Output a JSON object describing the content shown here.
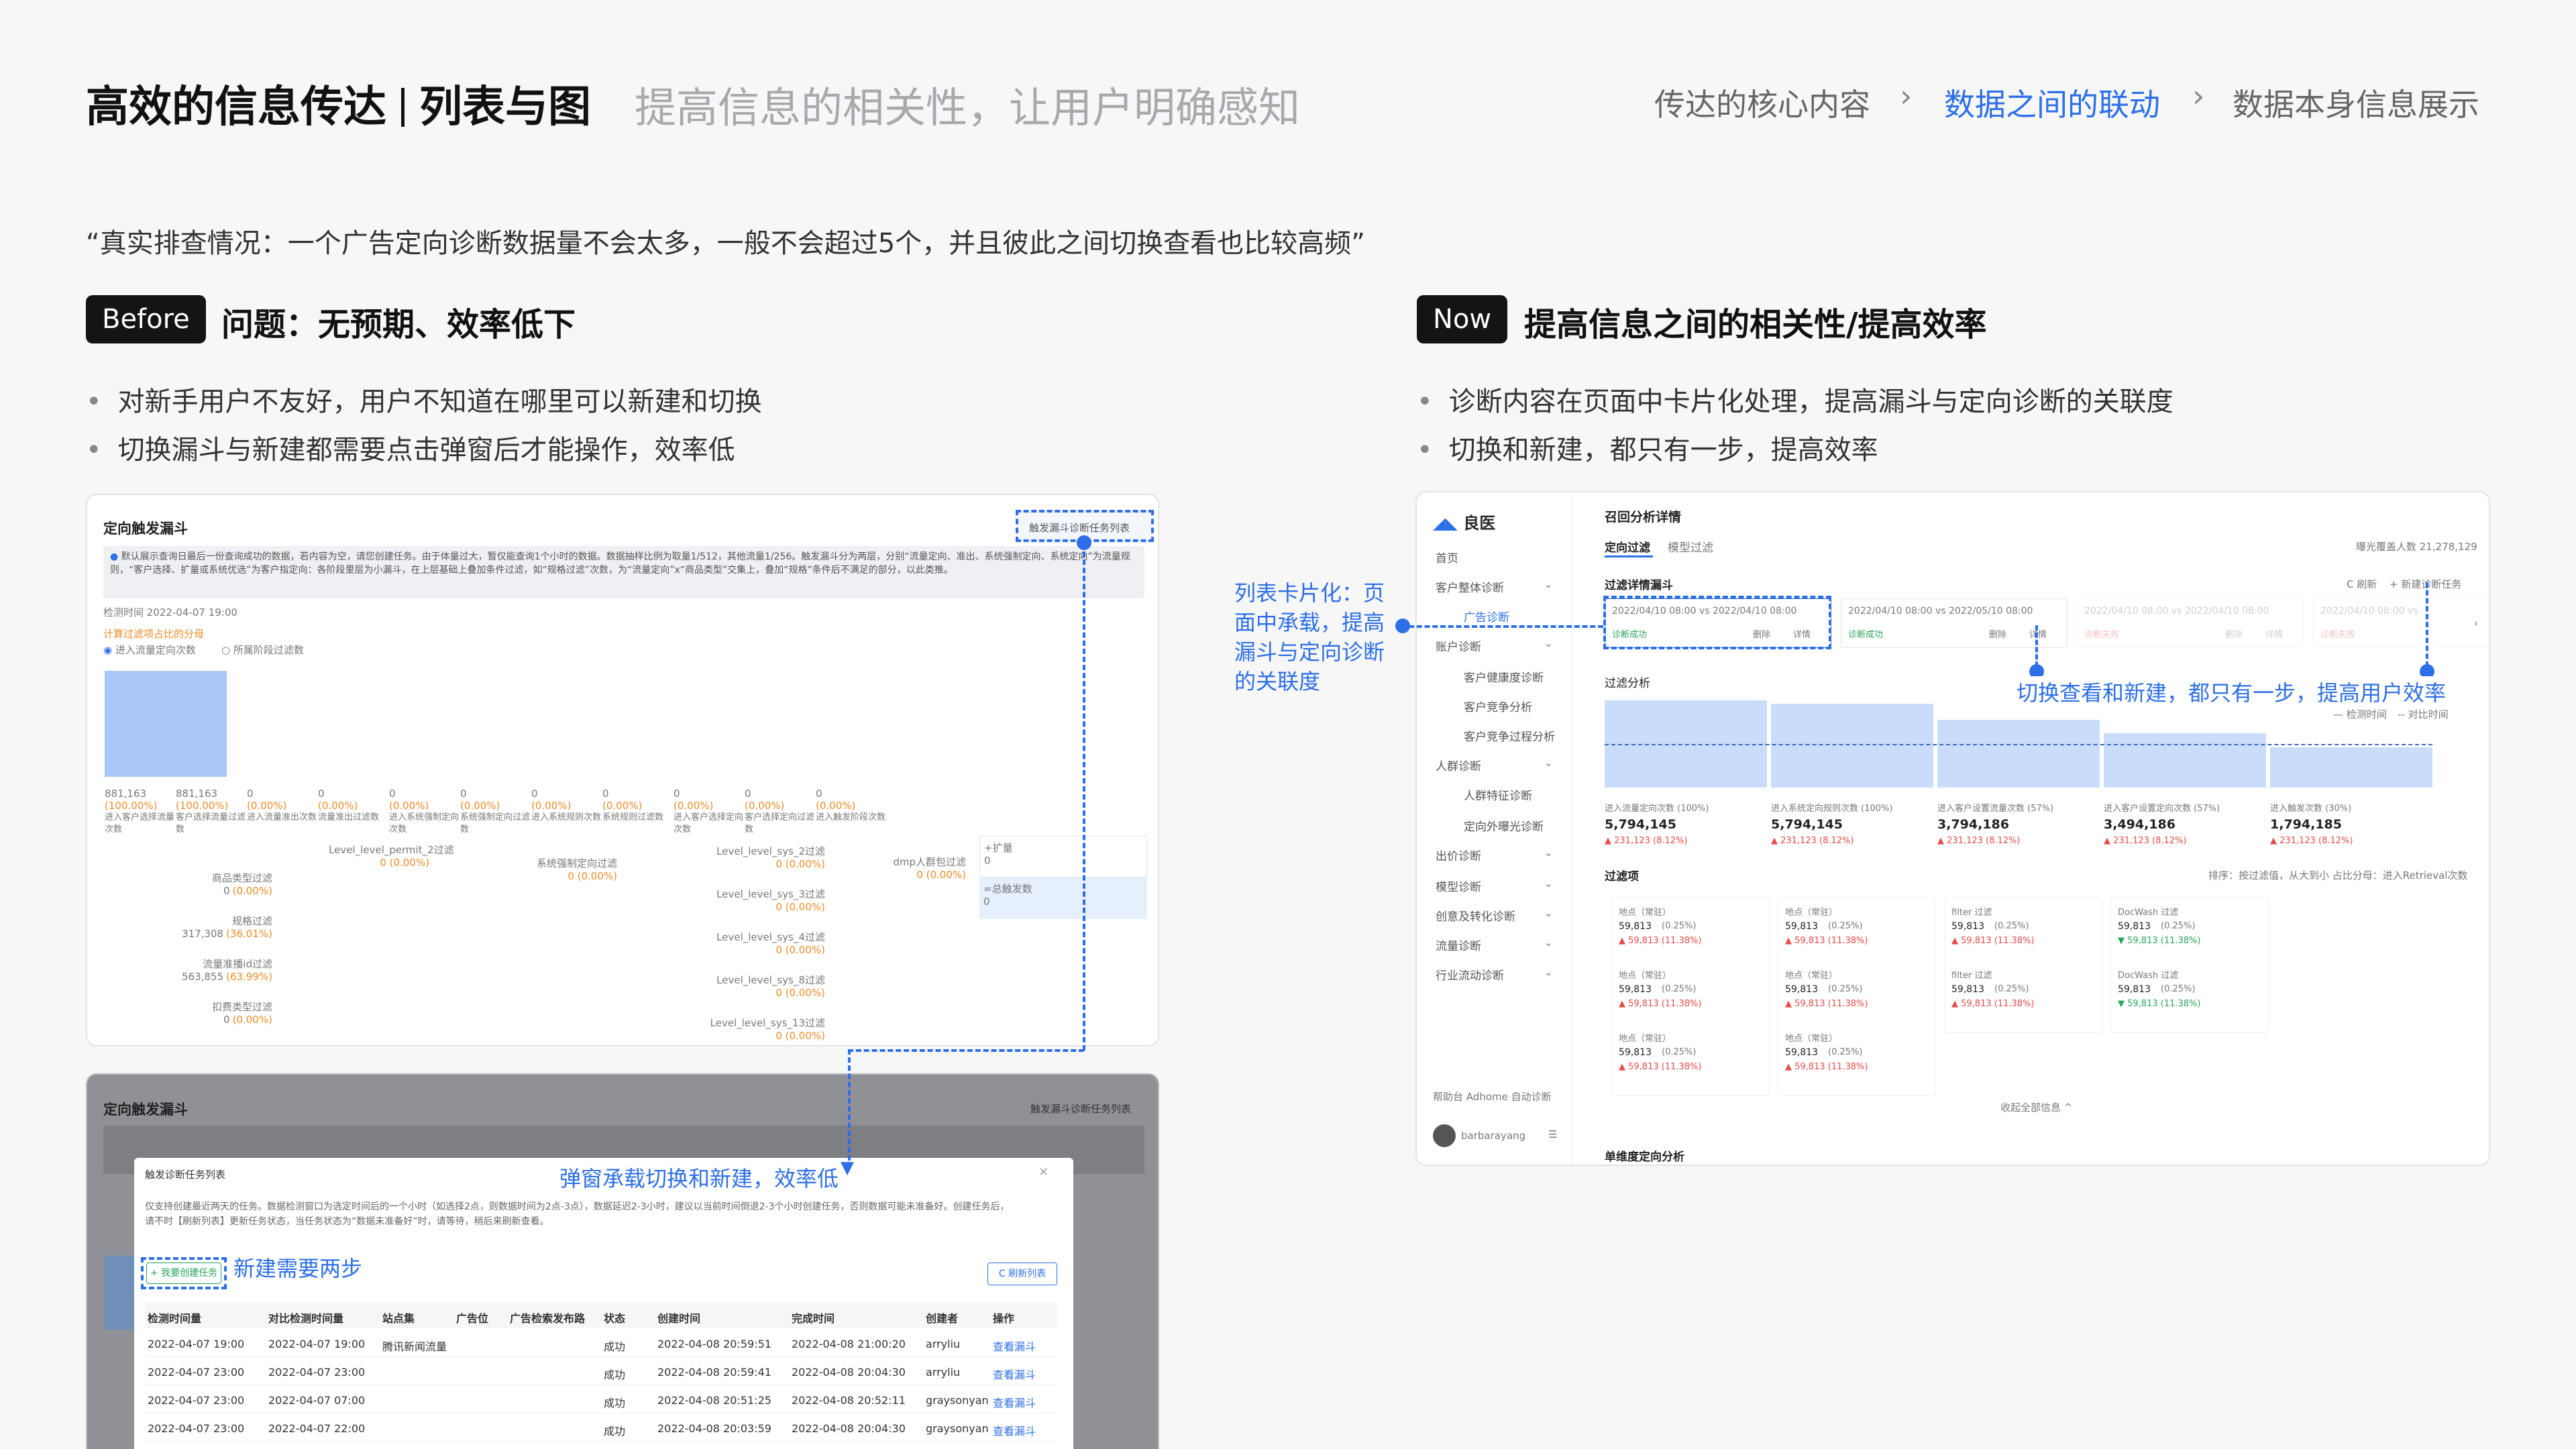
{
  "header": {
    "title_a": "高效的信息传达",
    "title_b": "列表与图",
    "subtitle": "提高信息的相关性，让用户明确感知",
    "breadcrumbs": [
      "传达的核心内容",
      "数据之间的联动",
      "数据本身信息展示"
    ],
    "active_crumb_index": 1
  },
  "quote": "“真实排查情况：一个广告定向诊断数据量不会太多，一般不会超过5个，并且彼此之间切换查看也比较高频”",
  "before": {
    "tag": "Before",
    "heading": "问题：无预期、效率低下",
    "bullets": [
      "对新手用户不友好，用户不知道在哪里可以新建和切换",
      "切换漏斗与新建都需要点击弹窗后才能操作，效率低"
    ]
  },
  "now": {
    "tag": "Now",
    "heading": "提高信息之间的相关性/提高效率",
    "bullets": [
      "诊断内容在页面中卡片化处理，提高漏斗与定向诊断的关联度",
      "切换和新建，都只有一步，提高效率"
    ]
  },
  "annotations": {
    "popup": "弹窗承载切换和新建，效率低",
    "two_steps": "新建需要两步",
    "cards": "列表卡片化：页面中承载，提高漏斗与定向诊断的关联度",
    "one_step": "切换查看和新建，都只有一步，提高用户效率"
  },
  "before_shot": {
    "title": "定向触发漏斗",
    "task_list_btn": "触发漏斗诊断任务列表",
    "notice": "默认展示查询日最后一份查询成功的数据，若内容为空，请您创建任务。由于体量过大，暂仅能查询1个小时的数据。数据抽样比例为取量1/512，其他流量1/256。触发漏斗分为两层，分别“流量定向、准出、系统强制定向、系统定向”为流量规则，“客户选择、扩量或系统优选”为客户指定向：各阶段里层为小漏斗，在上层基础上叠加条件过滤，如“规格过滤”次数，为“流量定向”x“商品类型”交集上，叠加“规格”条件后不满足的部分，以此类推。",
    "check_time": "检测时间 2022-04-07 19:00",
    "filter_label": "计算过滤项占比的分母",
    "radio_a": "进入流量定向次数",
    "radio_b": "所属阶段过滤数",
    "stage_cols": [
      {
        "v": "881,163",
        "p": "(100.00%)",
        "l": "进入客户选择流量次数"
      },
      {
        "v": "881,163",
        "p": "(100.00%)",
        "l": "客户选择流量过滤数"
      },
      {
        "v": "0",
        "p": "(0.00%)",
        "l": "进入流量准出次数"
      },
      {
        "v": "0",
        "p": "(0.00%)",
        "l": "流量准出过滤数"
      },
      {
        "v": "0",
        "p": "(0.00%)",
        "l": "进入系统强制定向次数"
      },
      {
        "v": "0",
        "p": "(0.00%)",
        "l": "系统强制定向过滤数"
      },
      {
        "v": "0",
        "p": "(0.00%)",
        "l": "进入系统规则次数"
      },
      {
        "v": "0",
        "p": "(0.00%)",
        "l": "系统规则过滤数"
      },
      {
        "v": "0",
        "p": "(0.00%)",
        "l": "进入客户选择定向次数"
      },
      {
        "v": "0",
        "p": "(0.00%)",
        "l": "客户选择定向过滤数"
      },
      {
        "v": "0",
        "p": "(0.00%)",
        "l": "进入触发阶段次数"
      }
    ],
    "sub_filters": [
      {
        "l": "商品类型过滤",
        "v": "0",
        "p": "(0.00%)"
      },
      {
        "l": "规格过滤",
        "v": "317,308",
        "p": "(36.01%)"
      },
      {
        "l": "流量准播id过滤",
        "v": "563,855",
        "p": "(63.99%)"
      },
      {
        "l": "扣费类型过滤",
        "v": "0",
        "p": "(0.00%)"
      }
    ],
    "level_filters": [
      "Level_level_sys_2过滤",
      "Level_level_sys_3过滤",
      "Level_level_sys_4过滤",
      "Level_level_sys_8过滤",
      "Level_level_sys_13过滤"
    ],
    "level_permit": "Level_level_permit_2过滤",
    "sys_force": "系统强制定向过滤",
    "dmp": "dmp人群包过滤",
    "expand": "扩量",
    "total_trigger": "总触发数"
  },
  "popup_shot": {
    "title": "定向触发漏斗",
    "task_list_btn": "触发漏斗诊断任务列表",
    "dialog_title": "触发诊断任务列表",
    "dialog_desc": "仅支持创建最近两天的任务。数据检测窗口为选定时间后的一个小时（如选择2点，则数据时间为2点-3点），数据延迟2-3小时，建议以当前时间倒退2-3个小时创建任务，否则数据可能未准备好。创建任务后，请不时【刷新列表】更新任务状态，当任务状态为“数据未准备好”时，请等待，稍后来刷新查看。",
    "create_btn": "+ 我要创建任务",
    "refresh_btn": "C 刷新列表",
    "columns": [
      "检测时间量",
      "对比检测时间量",
      "站点集",
      "广告位",
      "广告检索发布路",
      "状态",
      "创建时间",
      "完成时间",
      "创建者",
      "操作"
    ],
    "rows": [
      [
        "2022-04-07 19:00",
        "2022-04-07 19:00",
        "腾讯新闻流量",
        "",
        "",
        "成功",
        "2022-04-08 20:59:51",
        "2022-04-08 21:00:20",
        "arryliu",
        "查看漏斗"
      ],
      [
        "2022-04-07 23:00",
        "2022-04-07 23:00",
        "",
        "",
        "",
        "成功",
        "2022-04-08 20:59:41",
        "2022-04-08 20:04:30",
        "arryliu",
        "查看漏斗"
      ],
      [
        "2022-04-07 23:00",
        "2022-04-07 07:00",
        "",
        "",
        "",
        "成功",
        "2022-04-08 20:51:25",
        "2022-04-08 20:52:11",
        "graysonyan",
        "查看漏斗"
      ],
      [
        "2022-04-07 23:00",
        "2022-04-07 22:00",
        "",
        "",
        "",
        "成功",
        "2022-04-08 20:03:59",
        "2022-04-08 20:04:30",
        "graysonyan",
        "查看漏斗"
      ]
    ]
  },
  "now_shot": {
    "brand": "良医",
    "nav": [
      "首页",
      "客户整体诊断",
      "广告诊断",
      "账户诊断",
      "客户健康度诊断",
      "客户竞争分析",
      "客户竞争过程分析",
      "人群诊断",
      "人群特征诊断",
      "定向外曝光诊断",
      "出价诊断",
      "模型诊断",
      "创意及转化诊断",
      "流量诊断",
      "行业流动诊断"
    ],
    "nav_active_index": 2,
    "footer_links": [
      "帮助台",
      "Adhome",
      "自动诊断"
    ],
    "user": "barbarayang",
    "page_title": "召回分析详情",
    "tabs": [
      "定向过滤",
      "模型过滤"
    ],
    "top_right_note": "曝光覆盖人数 21,278,129",
    "section_title": "过滤详情漏斗",
    "refresh": "C 刷新",
    "new_task": "+ 新建诊断任务",
    "task_cards": [
      {
        "range": "2022/04/10 08:00  vs  2022/04/10 08:00",
        "status": "诊断成功",
        "del": "删除",
        "detail": "详情"
      },
      {
        "range": "2022/04/10 08:00  vs  2022/05/10 08:00",
        "status": "诊断成功",
        "del": "删除",
        "detail": "详情"
      },
      {
        "range": "2022/04/10 08:00  vs  2022/04/10 08:00",
        "status": "诊断失败",
        "del": "删除",
        "detail": "详情"
      },
      {
        "range": "2022/04/10 08:00  vs",
        "status": "诊断失败",
        "del": "",
        "detail": ""
      }
    ],
    "filter_analysis": "过滤分析",
    "legend": [
      "检测时间",
      "对比时间"
    ],
    "funnel": [
      {
        "l": "进入流量定向次数 (100%)",
        "v": "5,794,145",
        "d": "▲ 231,123 (8.12%)"
      },
      {
        "l": "进入系统定向规则次数 (100%)",
        "v": "5,794,145",
        "d": "▲ 231,123 (8.12%)"
      },
      {
        "l": "进入客户设置流量次数 (57%)",
        "v": "3,794,186",
        "d": "▲ 231,123 (8.12%)"
      },
      {
        "l": "进入客户设置定向次数 (57%)",
        "v": "3,494,186",
        "d": "▲ 231,123 (8.12%)"
      },
      {
        "l": "进入触发次数 (30%)",
        "v": "1,794,185",
        "d": "▲ 231,123 (8.12%)"
      }
    ],
    "funnel_ratio": [
      1.0,
      0.96,
      0.78,
      0.62,
      0.46
    ],
    "filter_items_title": "过滤项",
    "filter_controls": "排序：按过滤值，从大到小    占比分母：进入Retrieval次数",
    "filter_cols": [
      [
        {
          "t": "地点（常驻）",
          "v": "59,813",
          "p": "(0.25%)",
          "d": "▲ 59,813 (11.38%)"
        },
        {
          "t": "地点（常驻）",
          "v": "59,813",
          "p": "(0.25%)",
          "d": "▲ 59,813 (11.38%)"
        },
        {
          "t": "地点（常驻）",
          "v": "59,813",
          "p": "(0.25%)",
          "d": "▲ 59,813 (11.38%)"
        }
      ],
      [
        {
          "t": "地点（常驻）",
          "v": "59,813",
          "p": "(0.25%)",
          "d": "▲ 59,813 (11.38%)"
        },
        {
          "t": "地点（常驻）",
          "v": "59,813",
          "p": "(0.25%)",
          "d": "▲ 59,813 (11.38%)"
        },
        {
          "t": "地点（常驻）",
          "v": "59,813",
          "p": "(0.25%)",
          "d": "▲ 59,813 (11.38%)"
        }
      ],
      [
        {
          "t": "filter 过滤",
          "v": "59,813",
          "p": "(0.25%)",
          "d": "▲ 59,813 (11.38%)"
        },
        {
          "t": "filter 过滤",
          "v": "59,813",
          "p": "(0.25%)",
          "d": "▲ 59,813 (11.38%)"
        }
      ],
      [
        {
          "t": "DocWash 过滤",
          "v": "59,813",
          "p": "(0.25%)",
          "d": "▼ 59,813 (11.38%)"
        },
        {
          "t": "DocWash 过滤",
          "v": "59,813",
          "p": "(0.25%)",
          "d": "▼ 59,813 (11.38%)"
        }
      ]
    ],
    "collapse": "收起全部信息 ^",
    "bottom_title": "单维度定向分析"
  }
}
